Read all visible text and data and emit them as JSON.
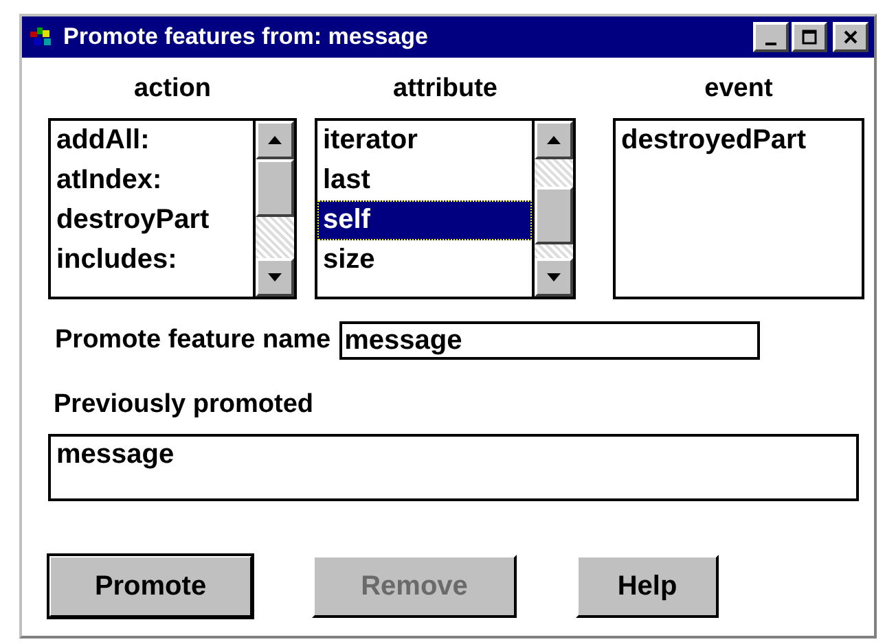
{
  "window": {
    "title": "Promote features from: message"
  },
  "lists": [
    {
      "heading": "action",
      "scrollbar": true,
      "items": [
        {
          "label": "addAll:",
          "selected": false
        },
        {
          "label": "atIndex:",
          "selected": false
        },
        {
          "label": "destroyPart",
          "selected": false
        },
        {
          "label": "includes:",
          "selected": false
        }
      ]
    },
    {
      "heading": "attribute",
      "scrollbar": true,
      "items": [
        {
          "label": "iterator",
          "selected": false
        },
        {
          "label": "last",
          "selected": false
        },
        {
          "label": "self",
          "selected": true
        },
        {
          "label": "size",
          "selected": false
        }
      ]
    },
    {
      "heading": "event",
      "scrollbar": false,
      "items": [
        {
          "label": "destroyedPart",
          "selected": false
        }
      ]
    }
  ],
  "feature_name": {
    "label": "Promote feature name",
    "value": "message"
  },
  "previously_promoted": {
    "label": "Previously promoted",
    "items": [
      "message"
    ]
  },
  "buttons": [
    {
      "label": "Promote",
      "disabled": false
    },
    {
      "label": "Remove",
      "disabled": true
    },
    {
      "label": "Help",
      "disabled": false
    }
  ]
}
